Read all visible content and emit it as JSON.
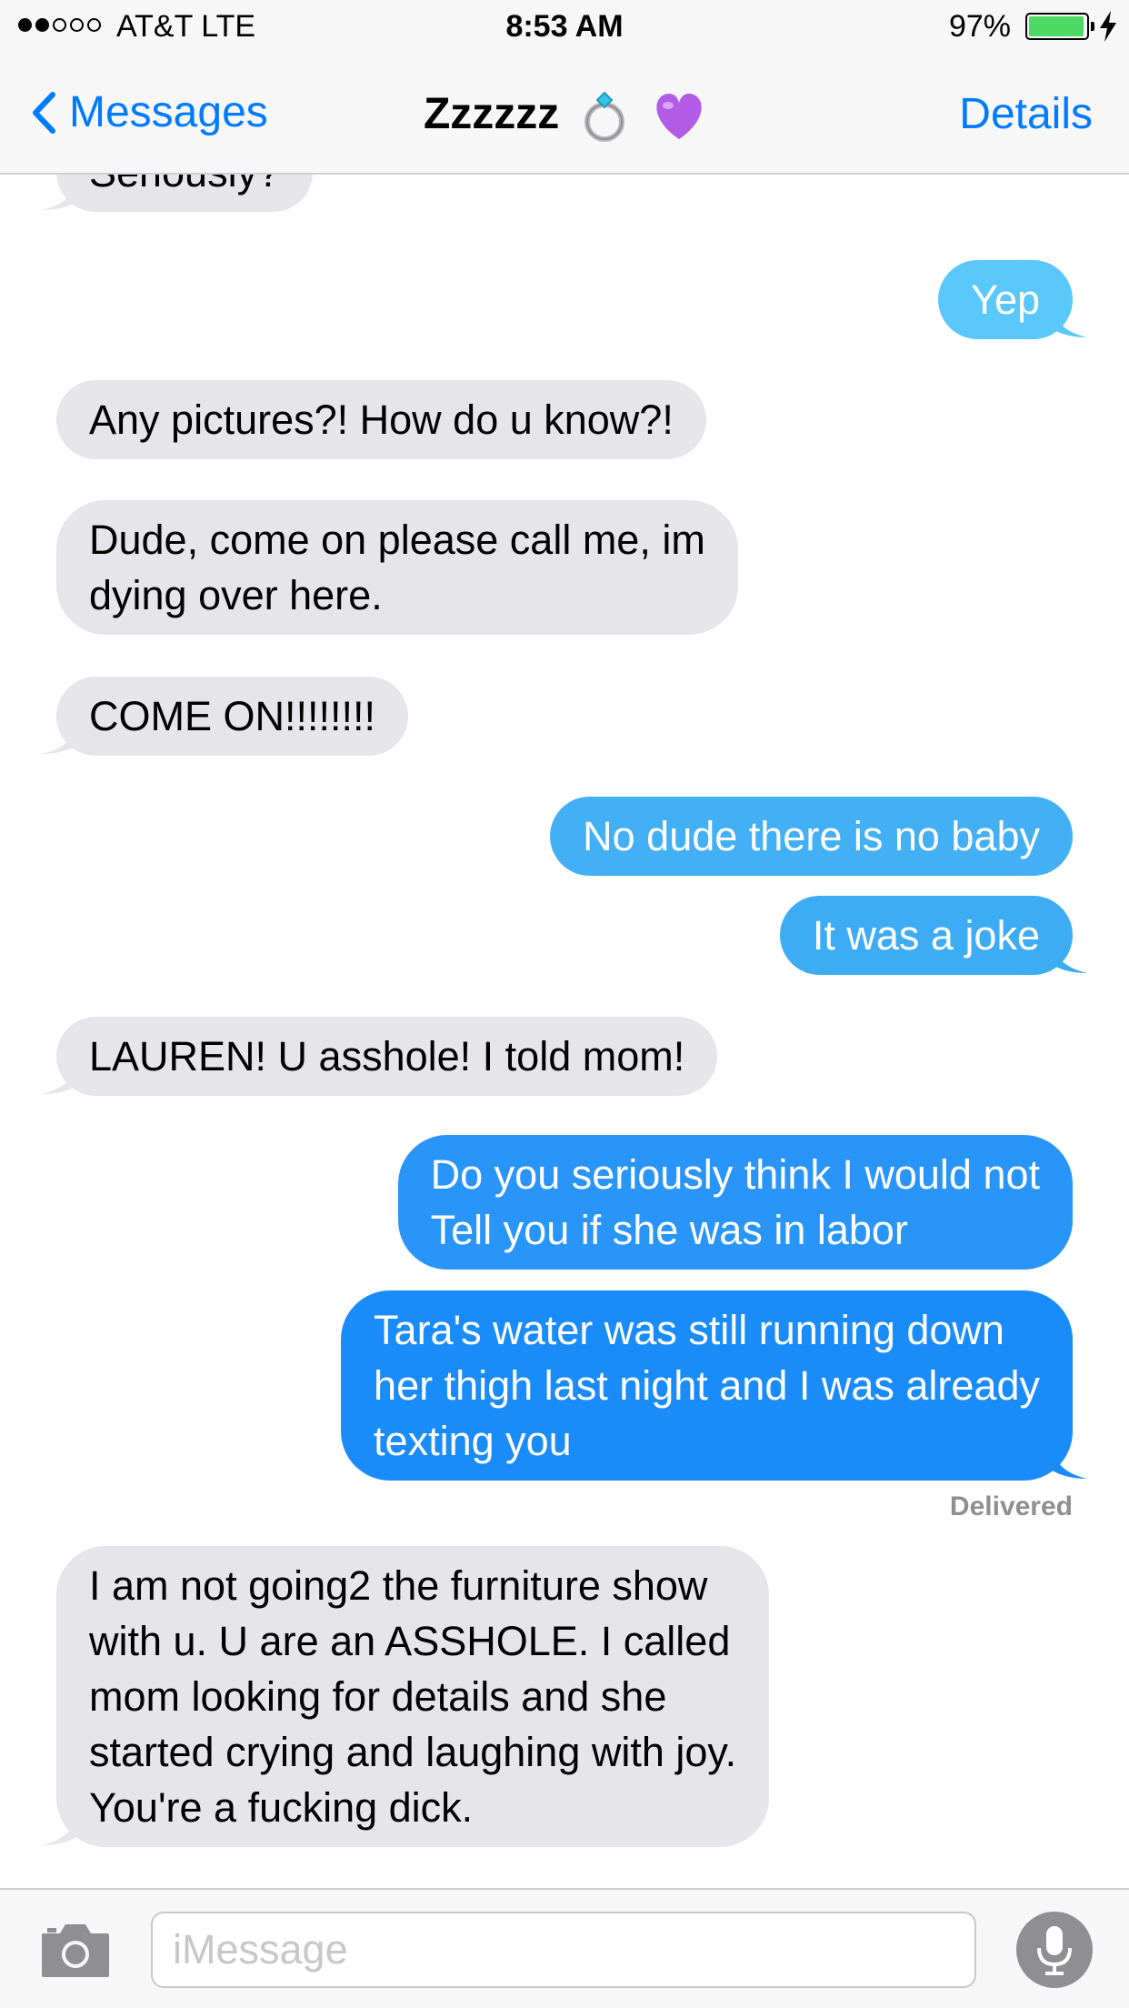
{
  "status_bar": {
    "signal_dots_filled": 2,
    "signal_dots_total": 5,
    "carrier": "AT&T  LTE",
    "time": "8:53 AM",
    "battery_percent": "97%",
    "battery_level": 0.97,
    "battery_color": "#4cd964",
    "charging_icon": "bolt-icon"
  },
  "nav": {
    "back_label": "Messages",
    "title": "Zzzzzz",
    "title_emojis": [
      "ring-emoji",
      "purple-heart-emoji"
    ],
    "details_label": "Details",
    "accent_color": "#007aff"
  },
  "messages": [
    {
      "direction": "in",
      "text": "Seriously?"
    },
    {
      "direction": "out",
      "text": "Yep",
      "color": "#5ac8fa"
    },
    {
      "direction": "in",
      "text": "Any pictures?! How do u know?!"
    },
    {
      "direction": "in",
      "text": "Dude, come on please call me, im\ndying over here."
    },
    {
      "direction": "in",
      "text": "COME ON!!!!!!!!"
    },
    {
      "direction": "out",
      "text": "No dude there is no baby",
      "color": "#43b0f6"
    },
    {
      "direction": "out",
      "text": "It was a joke",
      "color": "#3eacf5"
    },
    {
      "direction": "in",
      "text": "LAUREN! U asshole! I told mom!"
    },
    {
      "direction": "out",
      "text": "Do you seriously think I would not\nTell you if she was in labor",
      "color": "#2a95f9"
    },
    {
      "direction": "out",
      "text": "Tara's water was still running down\nher thigh last night and I was already\ntexting you",
      "color": "#1a8cfa"
    },
    {
      "direction": "in",
      "text": "I am not going2 the furniture show\nwith u. U are an ASSHOLE. I called\nmom looking for details and she\nstarted crying and laughing with joy.\nYou're a fucking dick."
    }
  ],
  "delivered_label": "Delivered",
  "input": {
    "placeholder": "iMessage",
    "value": "",
    "camera_icon": "camera-icon",
    "mic_icon": "microphone-icon"
  }
}
